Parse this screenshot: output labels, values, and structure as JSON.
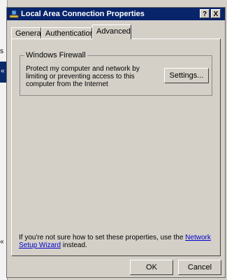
{
  "window": {
    "title": "Local Area Connection Properties",
    "help_button": "?",
    "close_button": "X"
  },
  "tabs": [
    {
      "label": "General"
    },
    {
      "label": "Authentication"
    },
    {
      "label": "Advanced",
      "active": true
    }
  ],
  "firewall_group": {
    "legend": "Windows Firewall",
    "description": "Protect my computer and network by limiting or preventing access to this computer from the Internet",
    "settings_button": "Settings..."
  },
  "help": {
    "prefix": "If you're not sure how to set these properties, use the",
    "link": "Network Setup Wizard",
    "suffix": "instead."
  },
  "buttons": {
    "ok": "OK",
    "cancel": "Cancel"
  },
  "background_fragments": {
    "top": "s",
    "mid": "«",
    "low": "«"
  }
}
